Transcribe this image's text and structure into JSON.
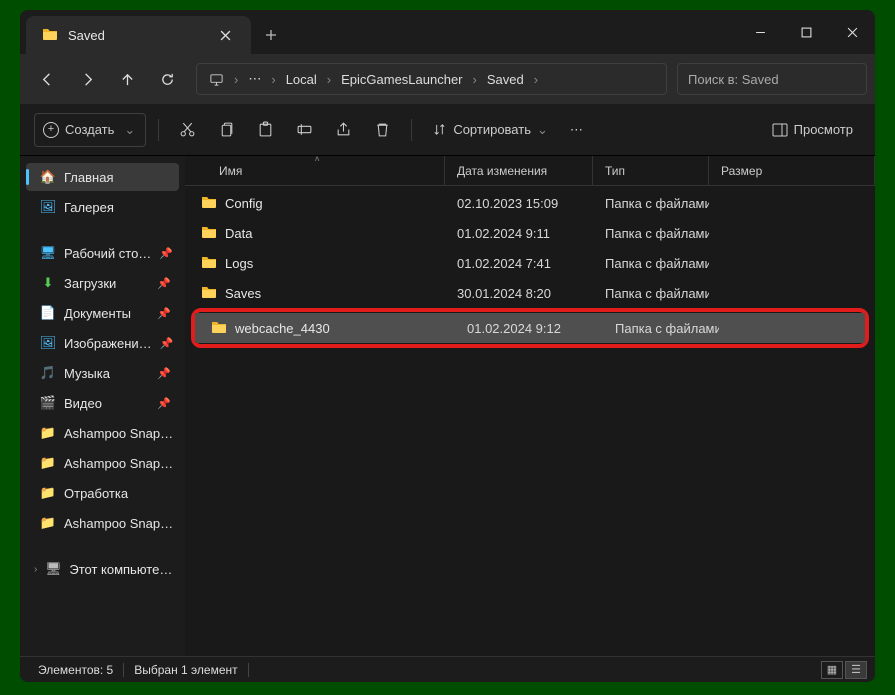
{
  "titlebar": {
    "tab_title": "Saved"
  },
  "breadcrumb": {
    "parts": [
      "Local",
      "EpicGamesLauncher",
      "Saved"
    ],
    "ellipsis": "⋯"
  },
  "search": {
    "placeholder": "Поиск в: Saved"
  },
  "toolbar": {
    "create": "Создать",
    "sort": "Сортировать",
    "view": "Просмотр"
  },
  "sidebar": {
    "home": "Главная",
    "gallery": "Галерея",
    "items": [
      {
        "label": "Рабочий сто…",
        "icon": "desktop",
        "pinned": true
      },
      {
        "label": "Загрузки",
        "icon": "download",
        "pinned": true
      },
      {
        "label": "Документы",
        "icon": "docs",
        "pinned": true
      },
      {
        "label": "Изображени…",
        "icon": "pictures",
        "pinned": true
      },
      {
        "label": "Музыка",
        "icon": "music",
        "pinned": true
      },
      {
        "label": "Видео",
        "icon": "video",
        "pinned": true
      },
      {
        "label": "Ashampoo Snap…",
        "icon": "folder",
        "pinned": false
      },
      {
        "label": "Ashampoo Snap…",
        "icon": "folder",
        "pinned": false
      },
      {
        "label": "Отработка",
        "icon": "folder",
        "pinned": false
      },
      {
        "label": "Ashampoo Snap…",
        "icon": "folder",
        "pinned": false
      }
    ],
    "thispc": "Этот компьюте…"
  },
  "columns": {
    "name": "Имя",
    "date": "Дата изменения",
    "type": "Тип",
    "size": "Размер"
  },
  "rows": [
    {
      "name": "Config",
      "date": "02.10.2023 15:09",
      "type": "Папка с файлами",
      "selected": false
    },
    {
      "name": "Data",
      "date": "01.02.2024 9:11",
      "type": "Папка с файлами",
      "selected": false
    },
    {
      "name": "Logs",
      "date": "01.02.2024 7:41",
      "type": "Папка с файлами",
      "selected": false
    },
    {
      "name": "Saves",
      "date": "30.01.2024 8:20",
      "type": "Папка с файлами",
      "selected": false
    },
    {
      "name": "webcache_4430",
      "date": "01.02.2024 9:12",
      "type": "Папка с файлами",
      "selected": true,
      "highlighted": true
    }
  ],
  "status": {
    "count": "Элементов: 5",
    "selected": "Выбран 1 элемент"
  }
}
